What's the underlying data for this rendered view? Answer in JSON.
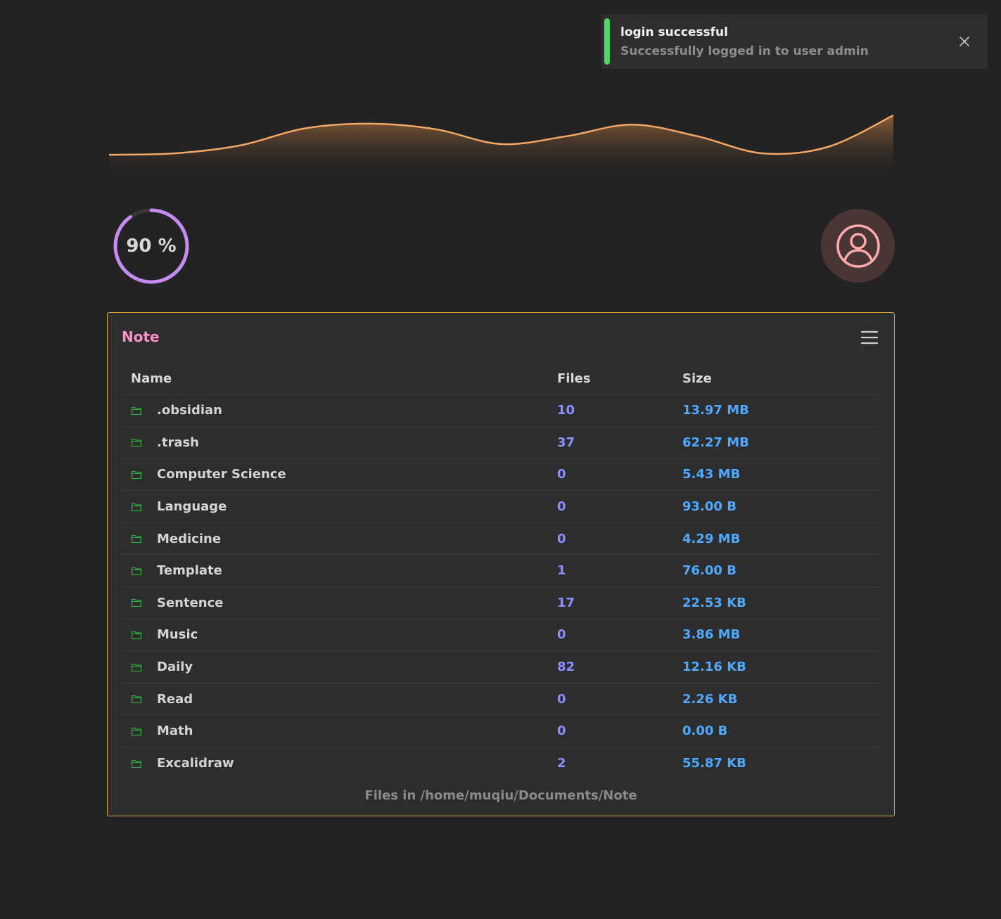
{
  "toast": {
    "title": "login successful",
    "message": "Successfully logged in to user admin",
    "accent_color": "#4cd964",
    "close_icon": "close-icon"
  },
  "wave_chart": {
    "type": "area",
    "values": [
      0.15,
      0.18,
      0.35,
      0.72,
      0.82,
      0.7,
      0.38,
      0.55,
      0.8,
      0.55,
      0.18,
      0.32,
      1.0
    ],
    "line_color": "#f2a766"
  },
  "progress": {
    "label": "90 %",
    "value": 0.9,
    "color": "#c58bf2"
  },
  "avatar": {
    "icon": "user-circle-icon",
    "color": "#ffaaaa"
  },
  "card": {
    "title": "Note",
    "menu_icon": "hamburger-menu-icon",
    "columns": [
      "Name",
      "Files",
      "Size"
    ],
    "rows": [
      {
        "name": ".obsidian",
        "files": "10",
        "size": "13.97 MB"
      },
      {
        "name": ".trash",
        "files": "37",
        "size": "62.27 MB"
      },
      {
        "name": "Computer Science",
        "files": "0",
        "size": "5.43 MB"
      },
      {
        "name": "Language",
        "files": "0",
        "size": "93.00 B"
      },
      {
        "name": "Medicine",
        "files": "0",
        "size": "4.29 MB"
      },
      {
        "name": "Template",
        "files": "1",
        "size": "76.00 B"
      },
      {
        "name": "Sentence",
        "files": "17",
        "size": "22.53 KB"
      },
      {
        "name": "Music",
        "files": "0",
        "size": "3.86 MB"
      },
      {
        "name": "Daily",
        "files": "82",
        "size": "12.16 KB"
      },
      {
        "name": "Read",
        "files": "0",
        "size": "2.26 KB"
      },
      {
        "name": "Math",
        "files": "0",
        "size": "0.00 B"
      },
      {
        "name": "Excalidraw",
        "files": "2",
        "size": "55.87 KB"
      }
    ],
    "row_icon": "folder-icon",
    "footer": "Files in /home/muqiu/Documents/Note"
  }
}
